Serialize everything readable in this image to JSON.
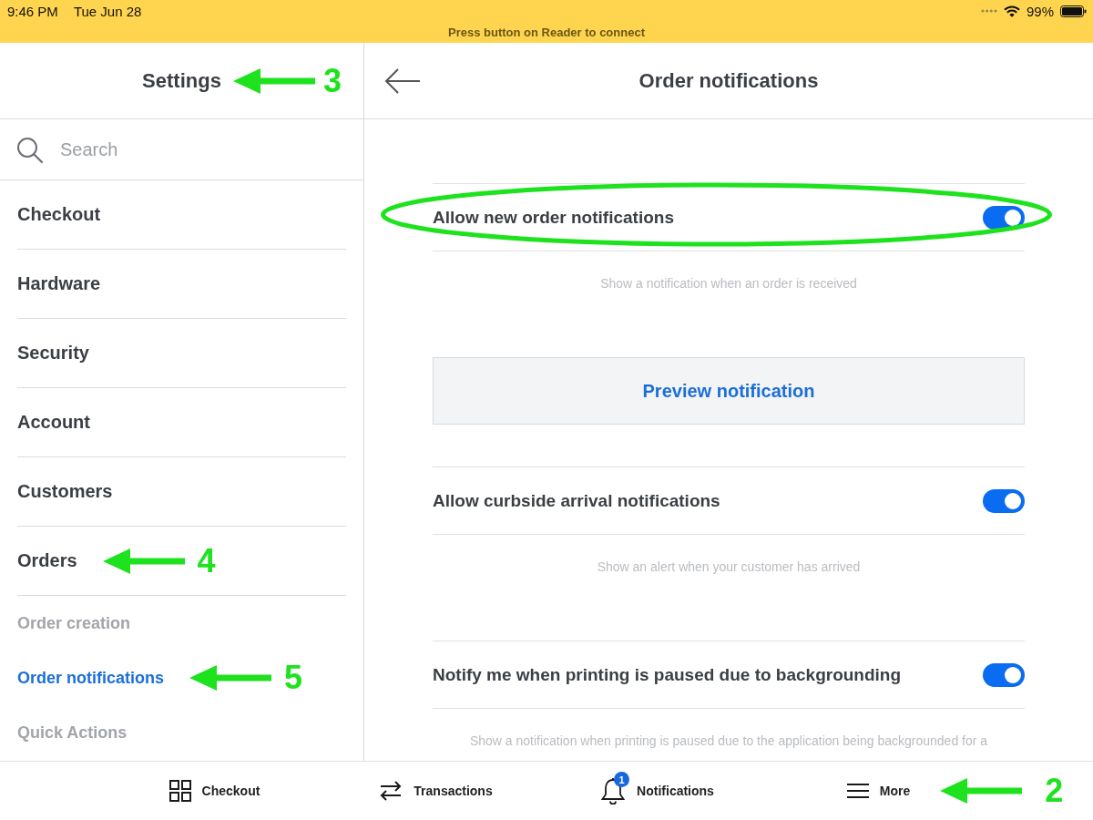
{
  "status_bar": {
    "time": "9:46 PM",
    "date": "Tue Jun 28",
    "battery": "99%"
  },
  "banner": {
    "text": "Press button on Reader to connect"
  },
  "sidebar": {
    "title": "Settings",
    "title_callout": "3",
    "search": {
      "placeholder": "Search"
    },
    "items": [
      {
        "label": "Checkout",
        "kind": "section",
        "selected": false
      },
      {
        "label": "Hardware",
        "kind": "section",
        "selected": false
      },
      {
        "label": "Security",
        "kind": "section",
        "selected": false
      },
      {
        "label": "Account",
        "kind": "section",
        "selected": false
      },
      {
        "label": "Customers",
        "kind": "section",
        "selected": false
      },
      {
        "label": "Orders",
        "kind": "section",
        "selected": false,
        "callout": "4"
      },
      {
        "label": "Order creation",
        "kind": "subitem",
        "selected": false
      },
      {
        "label": "Order notifications",
        "kind": "subitem",
        "selected": true,
        "callout": "5"
      },
      {
        "label": "Quick Actions",
        "kind": "subitem",
        "selected": false
      }
    ]
  },
  "detail": {
    "title": "Order notifications",
    "items": [
      {
        "kind": "toggle",
        "label": "Allow new order notifications",
        "on": true,
        "circled": true,
        "description": "Show a notification when an order is received"
      },
      {
        "kind": "button",
        "label": "Preview notification"
      },
      {
        "kind": "toggle",
        "label": "Allow curbside arrival notifications",
        "on": true,
        "description": "Show an alert when your customer has arrived"
      },
      {
        "kind": "toggle",
        "label": "Notify me when printing is paused due to backgrounding",
        "on": true,
        "description": "Show a notification when printing is paused due to the application being backgrounded for a"
      }
    ]
  },
  "tab_bar": {
    "tabs": [
      {
        "label": "Checkout"
      },
      {
        "label": "Transactions"
      },
      {
        "label": "Notifications",
        "badge": "1"
      },
      {
        "label": "More",
        "callout": "2"
      }
    ]
  }
}
